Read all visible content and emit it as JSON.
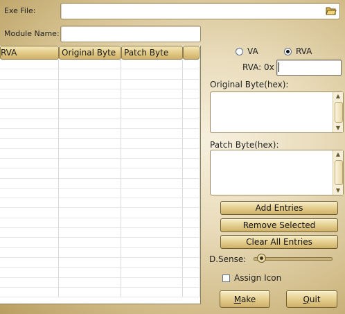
{
  "form": {
    "exe_file_label": "Exe File:",
    "exe_file_value": "",
    "module_name_label": "Module Name:",
    "module_name_value": ""
  },
  "table": {
    "columns": [
      "RVA",
      "Original Byte",
      "Patch Byte",
      ""
    ],
    "rows": []
  },
  "address_mode": {
    "options": [
      {
        "label": "VA",
        "selected": false
      },
      {
        "label": "RVA",
        "selected": true
      }
    ],
    "field_label": "RVA: 0x",
    "field_value": ""
  },
  "original_byte": {
    "label": "Original Byte(hex):",
    "value": ""
  },
  "patch_byte": {
    "label": "Patch Byte(hex):",
    "value": ""
  },
  "buttons": {
    "add": "Add Entries",
    "remove": "Remove Selected",
    "clear": "Clear All Entries",
    "make_accel": "M",
    "make_rest": "ake",
    "quit_accel": "Q",
    "quit_rest": "uit"
  },
  "dsense": {
    "label": "D.Sense:",
    "level": 0.1
  },
  "assign_icon": {
    "label": "Assign Icon",
    "checked": false
  },
  "colors": {
    "accent": "#d2bd8a",
    "button_border": "#6f5d30"
  }
}
